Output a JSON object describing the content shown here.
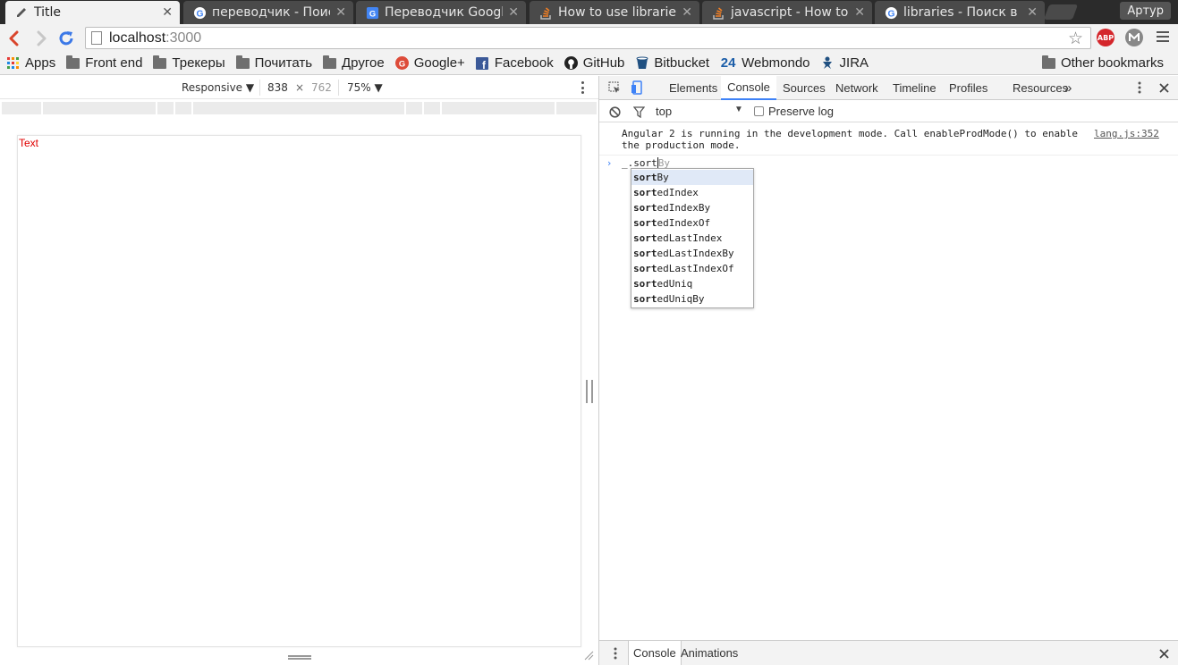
{
  "tabs": [
    {
      "title": "Title",
      "active": true,
      "favicon": "page-edit-icon"
    },
    {
      "title": "переводчик - Поиск",
      "active": false,
      "favicon": "google-icon"
    },
    {
      "title": "Переводчик Google",
      "active": false,
      "favicon": "google-translate-icon"
    },
    {
      "title": "How to use libraries",
      "active": false,
      "favicon": "stackoverflow-icon"
    },
    {
      "title": "javascript - How to b",
      "active": false,
      "favicon": "stackoverflow-icon"
    },
    {
      "title": "libraries - Поиск в Go",
      "active": false,
      "favicon": "google-icon"
    }
  ],
  "profile_name": "Артур",
  "omnibox": {
    "host": "localhost",
    "port": ":3000"
  },
  "extensions": {
    "abp_label": "ABP"
  },
  "bookmarks": [
    {
      "label": "Apps",
      "icon": "apps-grid-icon"
    },
    {
      "label": "Front end",
      "icon": "folder-icon"
    },
    {
      "label": "Трекеры",
      "icon": "folder-icon"
    },
    {
      "label": "Почитать",
      "icon": "folder-icon"
    },
    {
      "label": "Другое",
      "icon": "folder-icon"
    },
    {
      "label": "Google+",
      "icon": "google-plus-icon"
    },
    {
      "label": "Facebook",
      "icon": "facebook-icon"
    },
    {
      "label": "GitHub",
      "icon": "github-icon"
    },
    {
      "label": "Bitbucket",
      "icon": "bitbucket-icon"
    },
    {
      "label": "Webmondo",
      "icon": "webmondo-icon",
      "icon_text": "24"
    },
    {
      "label": "JIRA",
      "icon": "jira-icon"
    }
  ],
  "other_bookmarks": "Other bookmarks",
  "device_toolbar": {
    "mode": "Responsive",
    "width": "838",
    "times": "×",
    "height": "762",
    "zoom": "75%"
  },
  "page_content": {
    "text": "Text",
    "text_color": "#e00000"
  },
  "devtools": {
    "tabs": [
      "Elements",
      "Console",
      "Sources",
      "Network",
      "Timeline",
      "Profiles",
      "Resources"
    ],
    "selected_tab": "Console",
    "more_tabs": "»",
    "context": "top",
    "preserve_log_label": "Preserve log",
    "preserve_log_checked": false,
    "message": {
      "text": "Angular 2 is running in the development mode. Call enableProdMode() to enable the production mode.",
      "source": "lang.js:352"
    },
    "prompt": {
      "typed": "_.sort",
      "ghost": "By"
    },
    "suggestions": {
      "prefix": "sort",
      "selected_index": 0,
      "items": [
        "sortBy",
        "sortedIndex",
        "sortedIndexBy",
        "sortedIndexOf",
        "sortedLastIndex",
        "sortedLastIndexBy",
        "sortedLastIndexOf",
        "sortedUniq",
        "sortedUniqBy"
      ]
    },
    "drawer_tabs": [
      "Console",
      "Animations"
    ]
  },
  "colors": {
    "accent": "#3e82f7",
    "abp": "#d4262b",
    "mega": "#888888"
  }
}
